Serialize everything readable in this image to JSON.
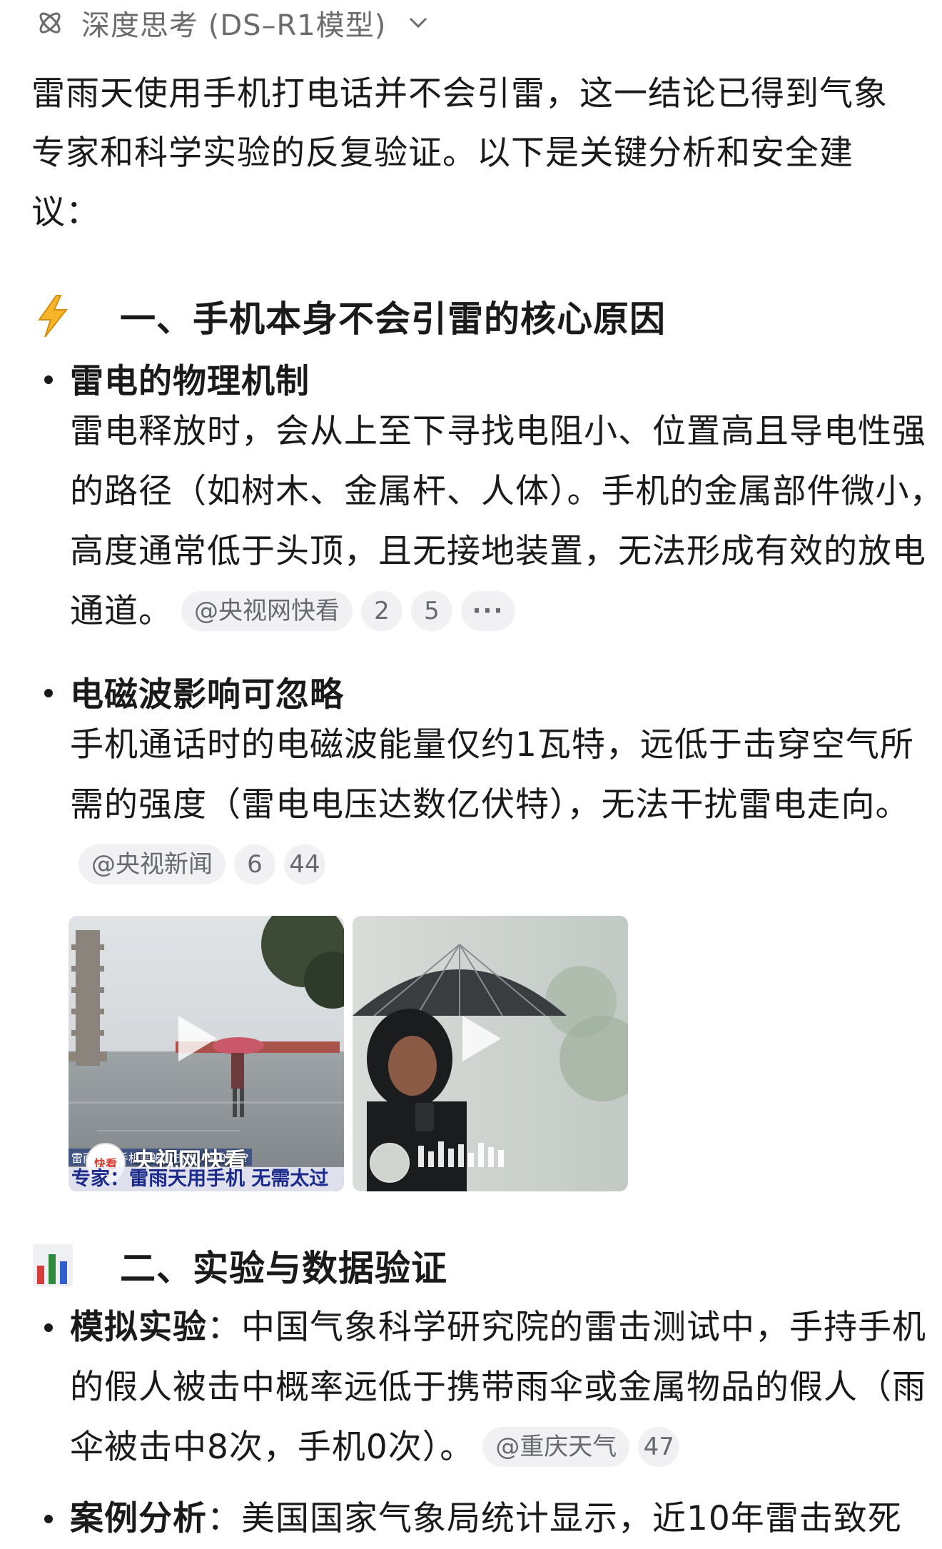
{
  "header": {
    "label": "深度思考 (DS–R1模型)"
  },
  "intro": "雷雨天使用手机打电话并不会引雷，这一结论已得到气象专家和科学实验的反复验证。以下是关键分析和安全建议：",
  "section1": {
    "title": "一、手机本身不会引雷的核心原因",
    "emoji_icon": "lightning-icon",
    "bullets": [
      {
        "title": "雷电的物理机制",
        "body": "雷电释放时，会从上至下寻找电阻小、位置高且导电性强的路径（如树木、金属杆、人体）。手机的金属部件微小，高度通常低于头顶，且无接地装置，无法形成有效的放电通道。",
        "source": "@央视网快看",
        "refs": [
          "2",
          "5"
        ],
        "more": "···"
      },
      {
        "title": "电磁波影响可忽略",
        "body": "手机通话时的电磁波能量仅约1瓦特，远低于击穿空气所需的强度（雷电电压达数亿伏特），无法干扰雷电走向。",
        "source": "@央视新闻",
        "refs": [
          "6",
          "44"
        ]
      }
    ],
    "videos": [
      {
        "channel": "央视网快看",
        "avatar_text": "快看",
        "caption_small": "雷雨天用手机会被雷击中，真的吗?",
        "caption": "专家：雷雨天用手机 无需太过"
      },
      {
        "channel": "",
        "avatar_text": ""
      }
    ]
  },
  "section2": {
    "title": "二、实验与数据验证",
    "emoji_icon": "bar-chart-icon",
    "bullets": [
      {
        "lead": "模拟实验",
        "body": "：中国气象科学研究院的雷击测试中，手持手机的假人被击中概率远低于携带雨伞或金属物品的假人（雨伞被击中8次，手机0次）。",
        "source": "@重庆天气",
        "refs": [
          "47"
        ]
      },
      {
        "lead": "案例分析",
        "body": "：美国国家气象局统计显示，近10年雷击致死"
      }
    ]
  },
  "colors": {
    "text": "#1a1a1a",
    "muted": "#6b6b6b",
    "pill_bg": "#f1f1f3",
    "pill_text": "#666a70"
  }
}
